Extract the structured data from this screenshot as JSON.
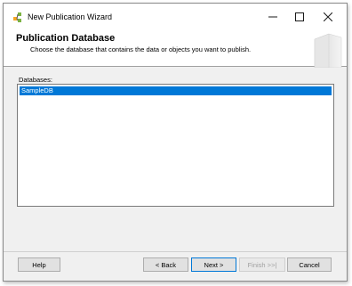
{
  "window": {
    "title": "New Publication Wizard"
  },
  "header": {
    "title": "Publication Database",
    "subtitle": "Choose the database that contains the data or objects you want to publish."
  },
  "databases": {
    "label": "Databases:",
    "items": [
      {
        "name": "SampleDB",
        "selected": true
      }
    ]
  },
  "buttons": {
    "help": "Help",
    "back": "< Back",
    "next": "Next >",
    "finish": "Finish >>|",
    "cancel": "Cancel"
  },
  "colors": {
    "selection": "#0078d7",
    "dialog_bg": "#f0f0f0"
  },
  "icons": {
    "app": "wizard-app-icon",
    "minimize": "minimize-icon",
    "maximize": "maximize-icon",
    "close": "close-icon",
    "header_art": "server-graphic"
  }
}
